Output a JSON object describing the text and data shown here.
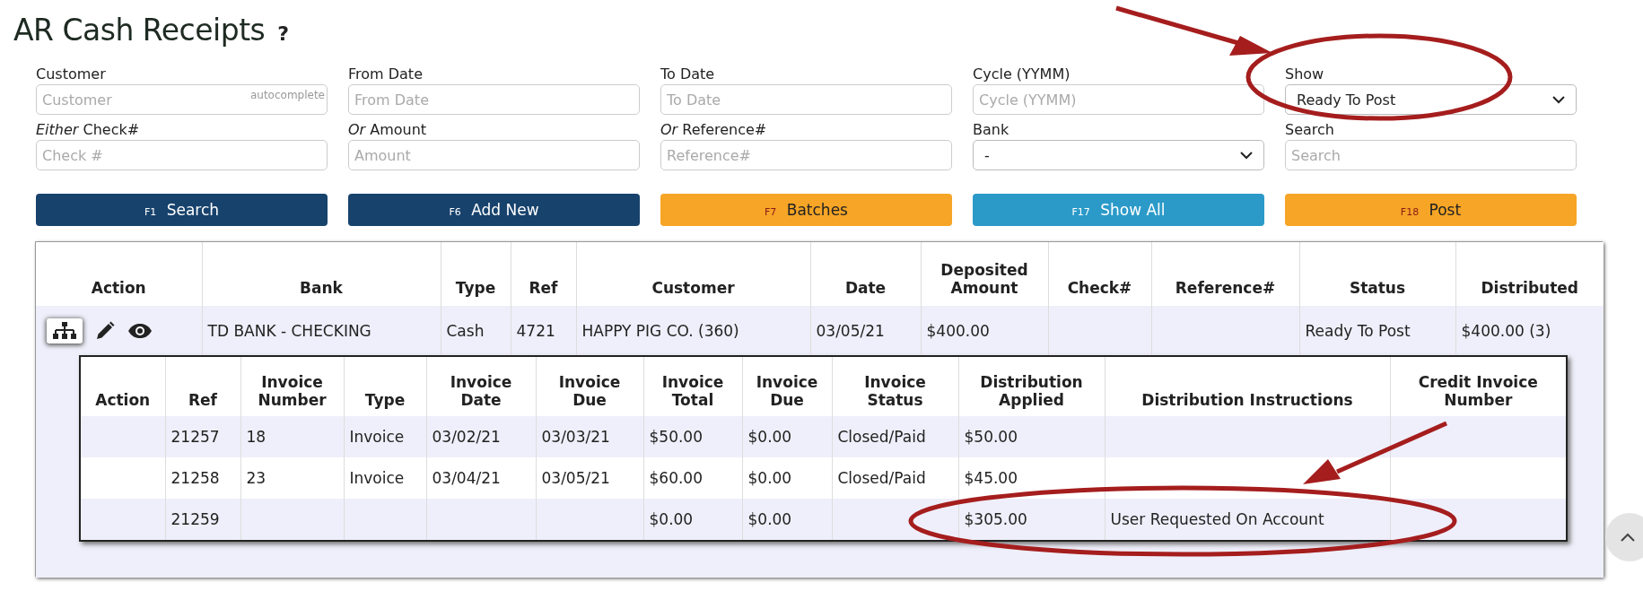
{
  "title": "AR Cash Receipts",
  "help": "?",
  "filters": [
    {
      "label": "Customer",
      "kind": "text",
      "placeholder": "Customer",
      "hint": "autocomplete"
    },
    {
      "label": "From Date",
      "kind": "text",
      "placeholder": "From Date"
    },
    {
      "label": "To Date",
      "kind": "text",
      "placeholder": "To Date"
    },
    {
      "label": "Cycle (YYMM)",
      "kind": "text",
      "placeholder": "Cycle (YYMM)"
    },
    {
      "label": "Show",
      "kind": "select",
      "value": "Ready To Post"
    },
    {
      "label": "*Either* Check#",
      "kind": "text",
      "placeholder": "Check #"
    },
    {
      "label": "*Or* Amount",
      "kind": "text",
      "placeholder": "Amount"
    },
    {
      "label": "*Or* Reference#",
      "kind": "text",
      "placeholder": "Reference#"
    },
    {
      "label": "Bank",
      "kind": "select",
      "value": "-"
    },
    {
      "label": "Search",
      "kind": "text",
      "placeholder": "Search"
    }
  ],
  "buttons": [
    {
      "key": "F1",
      "label": "Search",
      "kind": "primary"
    },
    {
      "key": "F6",
      "label": "Add New",
      "kind": "primary"
    },
    {
      "key": "F7",
      "label": "Batches",
      "kind": "warning"
    },
    {
      "key": "F17",
      "label": "Show All",
      "kind": "info"
    },
    {
      "key": "F18",
      "label": "Post",
      "kind": "warning"
    }
  ],
  "table": {
    "columns": [
      "Action",
      "Bank",
      "Type",
      "Ref",
      "Customer",
      "Date",
      "Deposited Amount",
      "Check#",
      "Reference#",
      "Status",
      "Distributed"
    ],
    "rows": [
      {
        "expanded": true,
        "cells": [
          "",
          "TD BANK - CHECKING",
          "Cash",
          "4721",
          "HAPPY PIG CO. (360)",
          "03/05/21",
          "$400.00",
          "",
          "",
          "Ready To Post",
          "$400.00 (3)"
        ],
        "details": {
          "columns": [
            "Action",
            "Ref",
            "Invoice Number",
            "Type",
            "Invoice Date",
            "Invoice Due",
            "Invoice Total",
            "Invoice Due",
            "Invoice Status",
            "Distribution Applied",
            "Distribution Instructions",
            "Credit Invoice Number"
          ],
          "rows": [
            [
              "",
              "21257",
              "18",
              "Invoice",
              "03/02/21",
              "03/03/21",
              "$50.00",
              "$0.00",
              "Closed/Paid",
              "$50.00",
              "",
              ""
            ],
            [
              "",
              "21258",
              "23",
              "Invoice",
              "03/04/21",
              "03/05/21",
              "$60.00",
              "$0.00",
              "Closed/Paid",
              "$45.00",
              "",
              ""
            ],
            [
              "",
              "21259",
              "",
              "",
              "",
              "",
              "$0.00",
              "$0.00",
              "",
              "$305.00",
              "User Requested On Account",
              ""
            ]
          ]
        }
      }
    ]
  }
}
